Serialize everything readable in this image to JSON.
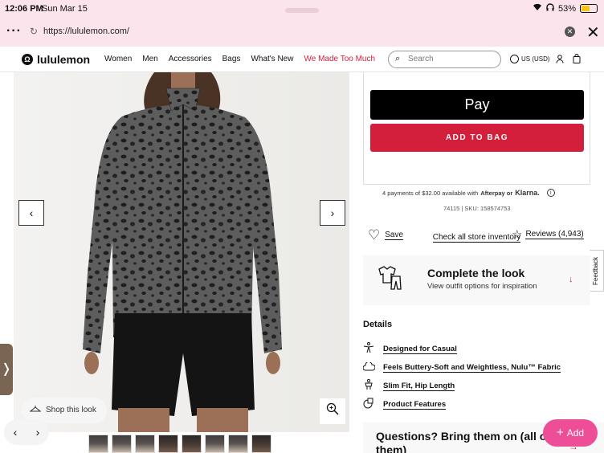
{
  "status_bar": {
    "time": "12:06 PM",
    "date": "Sun Mar 15",
    "battery": "53%",
    "battery_level": 0.53
  },
  "browser": {
    "url": "https://lululemon.com/"
  },
  "nav": {
    "logo": "lululemon",
    "links": [
      "Women",
      "Men",
      "Accessories",
      "Bags",
      "What's New",
      "We Made Too Much"
    ],
    "search_placeholder": "Search",
    "locale": "US (USD)"
  },
  "gallery": {
    "shop_look_label": "Shop this look"
  },
  "buy_box": {
    "apple_pay_label": "Pay",
    "add_to_bag_label": "ADD TO BAG",
    "inventory_link": "Check all store inventory",
    "installments_text": "4 payments of $32.00 available with",
    "afterpay_label": "Afterpay or",
    "klarna_label": "Klarna.",
    "sku_text": "74115 | SKU: 158574753"
  },
  "actions": {
    "save_label": "Save",
    "reviews_label": "Reviews (4,943)"
  },
  "feedback_label": "Feedback",
  "complete_look": {
    "title": "Complete the look",
    "subtitle": "View outfit options for inspiration"
  },
  "details": {
    "title": "Details",
    "items": [
      "Designed for Casual",
      "Feels Buttery-Soft and Weightless, Nulu™ Fabric",
      "Slim Fit, Hip Length",
      "Product Features"
    ]
  },
  "questions": {
    "text": "Questions? Bring them on (all of them)"
  },
  "fab": {
    "label": "Add"
  },
  "colors": {
    "accent_red": "#d31f3b",
    "fab_pink": "#ee4d98",
    "browser_chrome": "#fbe4ec"
  }
}
